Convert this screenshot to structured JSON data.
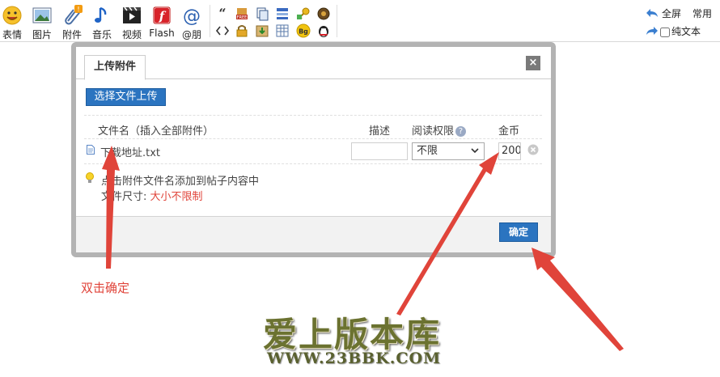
{
  "toolbar": {
    "items": [
      {
        "label": "表情",
        "icon": "smiley-icon"
      },
      {
        "label": "图片",
        "icon": "picture-icon"
      },
      {
        "label": "附件",
        "icon": "paperclip-icon"
      },
      {
        "label": "音乐",
        "icon": "music-note-icon"
      },
      {
        "label": "视频",
        "icon": "video-icon"
      },
      {
        "label": "Flash",
        "icon": "flash-icon"
      },
      {
        "label": "@朋",
        "icon": "at-icon"
      }
    ],
    "small_icons": [
      "quote-icon",
      "free-icon",
      "copy-icon",
      "list-icon",
      "key-icon",
      "disc-icon",
      "code-icon",
      "lock-icon",
      "download-icon",
      "table-icon",
      "bg-icon",
      "qq-penguin-icon"
    ],
    "fullscreen_label": "全屏",
    "common_label": "常用",
    "plaintext_label": "纯文本",
    "plaintext_checked": false
  },
  "dialog": {
    "tab_label": "上传附件",
    "close_symbol": "×",
    "upload_button": "选择文件上传",
    "columns": {
      "filename": "文件名（插入全部附件）",
      "description": "描述",
      "permission": "阅读权限",
      "coins": "金币"
    },
    "file": {
      "name": "下载地址.txt",
      "description": "",
      "permission": "不限",
      "coins": "200"
    },
    "tip_line1": "点击附件文件名添加到帖子内容中",
    "tip_line2_label": "文件尺寸: ",
    "tip_line2_value": "大小不限制",
    "ok_button": "确定"
  },
  "annotation": {
    "label": "双击确定",
    "color": "#e0443a"
  },
  "watermark": {
    "title": "爱上版本库",
    "url": "WWW.23BBK.COM"
  },
  "colors": {
    "button_blue": "#2b74c0",
    "frame_gray": "#b3b3b3",
    "arrow_red": "#e0443a"
  }
}
